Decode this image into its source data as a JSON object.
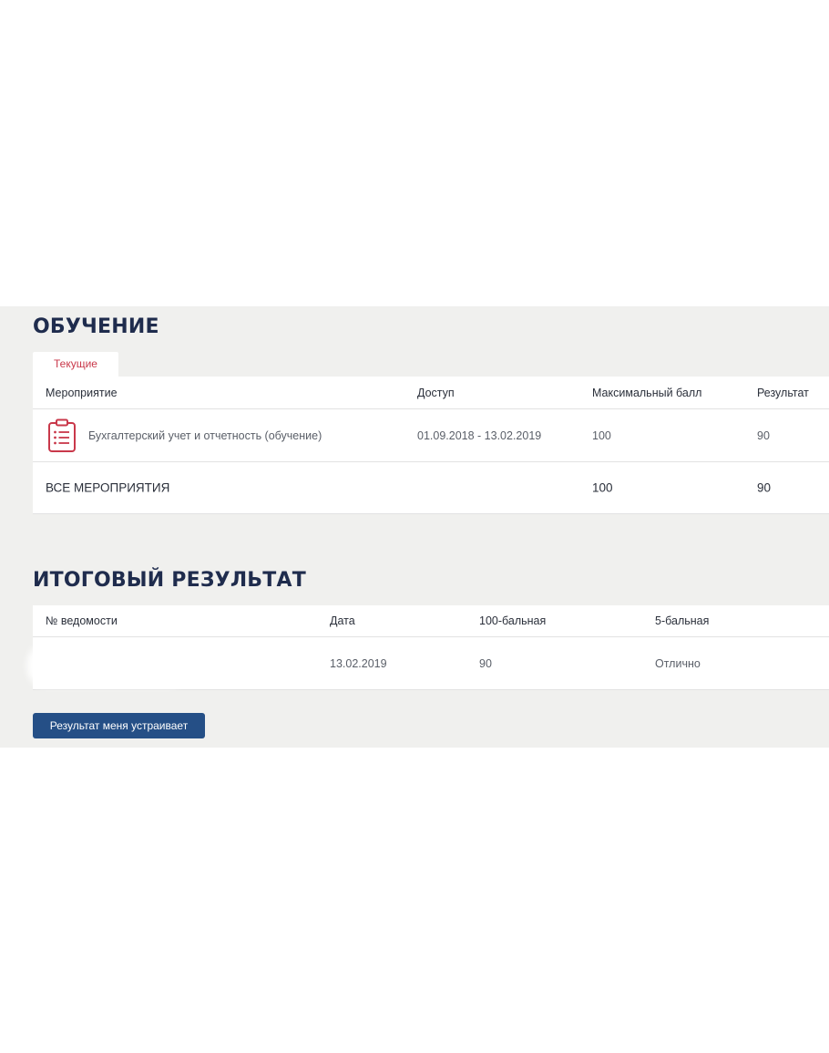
{
  "learning": {
    "title": "ОБУЧЕНИЕ",
    "tab_current": "Текущие",
    "columns": {
      "event": "Мероприятие",
      "access": "Доступ",
      "max_score": "Максимальный балл",
      "result": "Результат"
    },
    "rows": [
      {
        "icon": "clipboard-list-icon",
        "event": "Бухгалтерский учет и отчетность (обучение)",
        "access": "01.09.2018 - 13.02.2019",
        "max_score": "100",
        "result": "90"
      }
    ],
    "total": {
      "label": "ВСЕ МЕРОПРИЯТИЯ",
      "max_score": "100",
      "result": "90"
    }
  },
  "final": {
    "title": "ИТОГОВЫЙ РЕЗУЛЬТАТ",
    "columns": {
      "sheet_number": "№ ведомости",
      "date": "Дата",
      "score_100": "100-бальная",
      "score_5": "5-бальная"
    },
    "rows": [
      {
        "sheet_number": "",
        "date": "13.02.2019",
        "score_100": "90",
        "score_5": "Отлично"
      }
    ]
  },
  "actions": {
    "accept_label": "Результат меня устраивает"
  },
  "colors": {
    "panel_bg": "#f0f0ee",
    "title": "#1f2c4d",
    "tab_text": "#c9384a",
    "icon": "#c9384a",
    "button_bg": "#254f86"
  }
}
